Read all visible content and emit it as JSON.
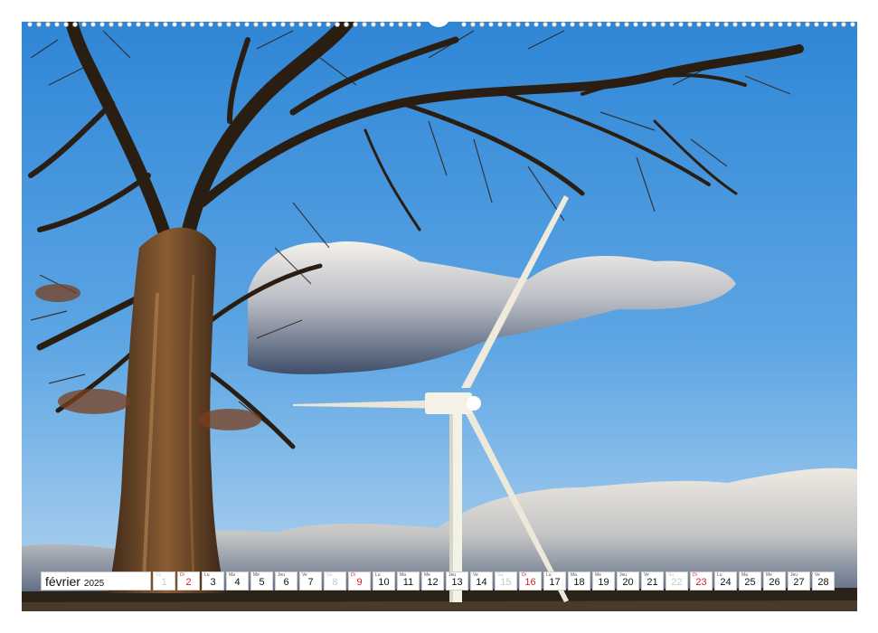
{
  "calendar": {
    "month": "février",
    "year": "2025",
    "days": [
      {
        "wd": "Sa",
        "n": "1",
        "type": "sat"
      },
      {
        "wd": "Di",
        "n": "2",
        "type": "sun"
      },
      {
        "wd": "Lu",
        "n": "3",
        "type": "week"
      },
      {
        "wd": "Ma",
        "n": "4",
        "type": "week"
      },
      {
        "wd": "Me",
        "n": "5",
        "type": "week"
      },
      {
        "wd": "Jeu",
        "n": "6",
        "type": "week"
      },
      {
        "wd": "Ve",
        "n": "7",
        "type": "week"
      },
      {
        "wd": "Sa",
        "n": "8",
        "type": "sat"
      },
      {
        "wd": "Di",
        "n": "9",
        "type": "sun"
      },
      {
        "wd": "Lu",
        "n": "10",
        "type": "week"
      },
      {
        "wd": "Ma",
        "n": "11",
        "type": "week"
      },
      {
        "wd": "Me",
        "n": "12",
        "type": "week"
      },
      {
        "wd": "Jeu",
        "n": "13",
        "type": "week"
      },
      {
        "wd": "Ve",
        "n": "14",
        "type": "week"
      },
      {
        "wd": "Sa",
        "n": "15",
        "type": "sat"
      },
      {
        "wd": "Di",
        "n": "16",
        "type": "sun"
      },
      {
        "wd": "Lu",
        "n": "17",
        "type": "week"
      },
      {
        "wd": "Ma",
        "n": "18",
        "type": "week"
      },
      {
        "wd": "Me",
        "n": "19",
        "type": "week"
      },
      {
        "wd": "Jeu",
        "n": "20",
        "type": "week"
      },
      {
        "wd": "Ve",
        "n": "21",
        "type": "week"
      },
      {
        "wd": "Sa",
        "n": "22",
        "type": "sat"
      },
      {
        "wd": "Di",
        "n": "23",
        "type": "sun"
      },
      {
        "wd": "Lu",
        "n": "24",
        "type": "week"
      },
      {
        "wd": "Ma",
        "n": "25",
        "type": "week"
      },
      {
        "wd": "Me",
        "n": "26",
        "type": "week"
      },
      {
        "wd": "Jeu",
        "n": "27",
        "type": "week"
      },
      {
        "wd": "Ve",
        "n": "28",
        "type": "week"
      }
    ],
    "colors": {
      "sunday": "#d0222a",
      "saturday": "#c9c9c9",
      "text": "#111111"
    }
  },
  "photo": {
    "subject": "bare tree and wind turbine under blue sky",
    "colors": {
      "sky_top": "#2f86d6",
      "sky_bottom": "#9cc8ee",
      "trunk": "#6b4a2b",
      "turbine": "#f2f2e8"
    }
  }
}
